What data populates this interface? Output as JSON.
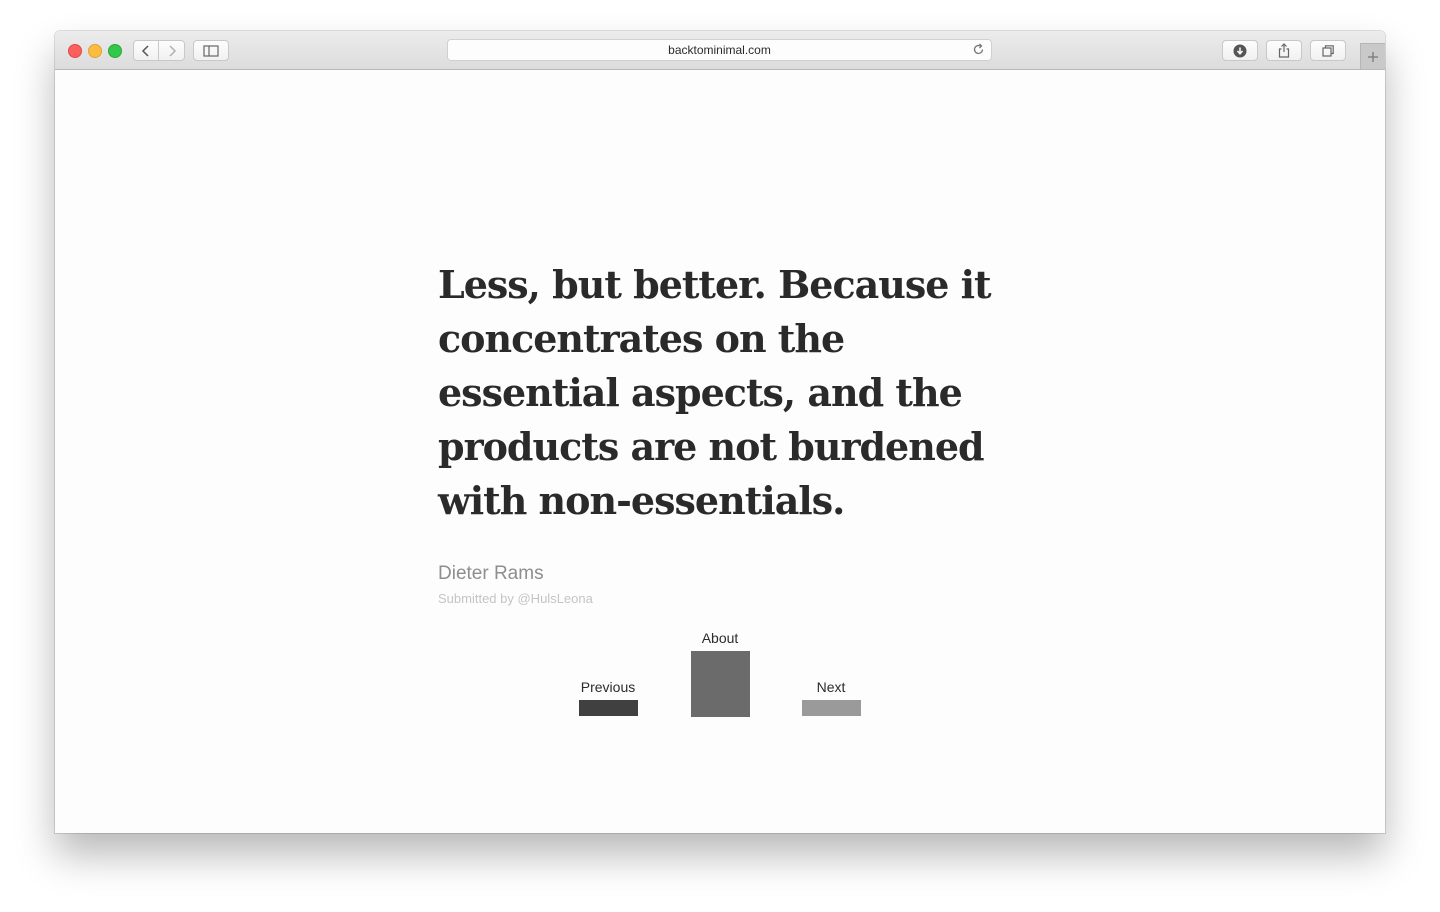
{
  "browser": {
    "url": "backtominimal.com"
  },
  "quote": {
    "text": "Less, but better. Because it concentrates on the essential aspects, and the products are not burdened with non-essentials.",
    "author": "Dieter Rams",
    "submitted_by": "Submitted by @HulsLeona"
  },
  "nav": {
    "previous": {
      "label": "Previous",
      "color": "#404040"
    },
    "about": {
      "label": "About",
      "color": "#6b6b6b"
    },
    "next": {
      "label": "Next",
      "color": "#9a9a9a"
    }
  },
  "colors": {
    "quote_text": "#2a2a2a",
    "author_text": "#8e8e8e",
    "submitted_text": "#c4c4c4"
  },
  "icons": [
    "back-icon",
    "forward-icon",
    "sidebar-icon",
    "reload-icon",
    "download-icon",
    "share-icon",
    "tabs-icon",
    "plus-icon"
  ]
}
